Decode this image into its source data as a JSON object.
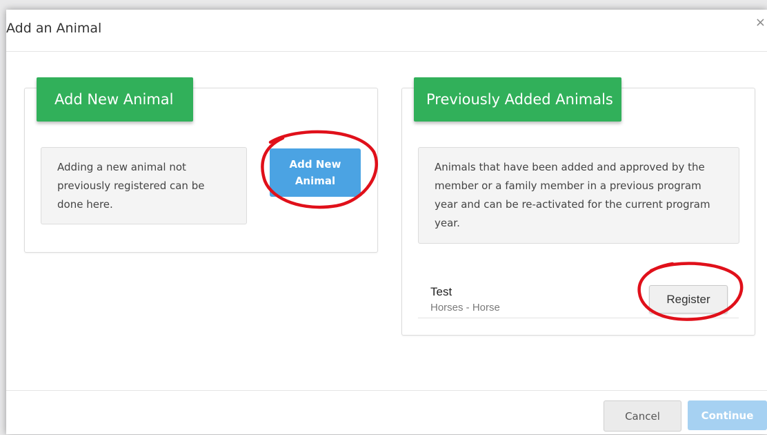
{
  "modal": {
    "title": "Add an Animal",
    "close_glyph": "×"
  },
  "new_animal_panel": {
    "heading": "Add New Animal",
    "description": "Adding a new animal not previously registered can be done here.",
    "button_label": "Add New Animal"
  },
  "previous_panel": {
    "heading": "Previously Added Animals",
    "description": "Animals that have been added and approved by the member or a family member in a previous program year and can be re-activated for the current program year.",
    "animals": [
      {
        "name": "Test",
        "type": "Horses - Horse",
        "action_label": "Register"
      }
    ]
  },
  "footer": {
    "cancel_label": "Cancel",
    "continue_label": "Continue"
  },
  "colors": {
    "heading_green": "#31b05a",
    "primary_blue": "#4ba3e3",
    "disabled_blue": "#a6d1f2",
    "annotation_red": "#e0101a"
  },
  "icons": {
    "close": "close-icon"
  }
}
